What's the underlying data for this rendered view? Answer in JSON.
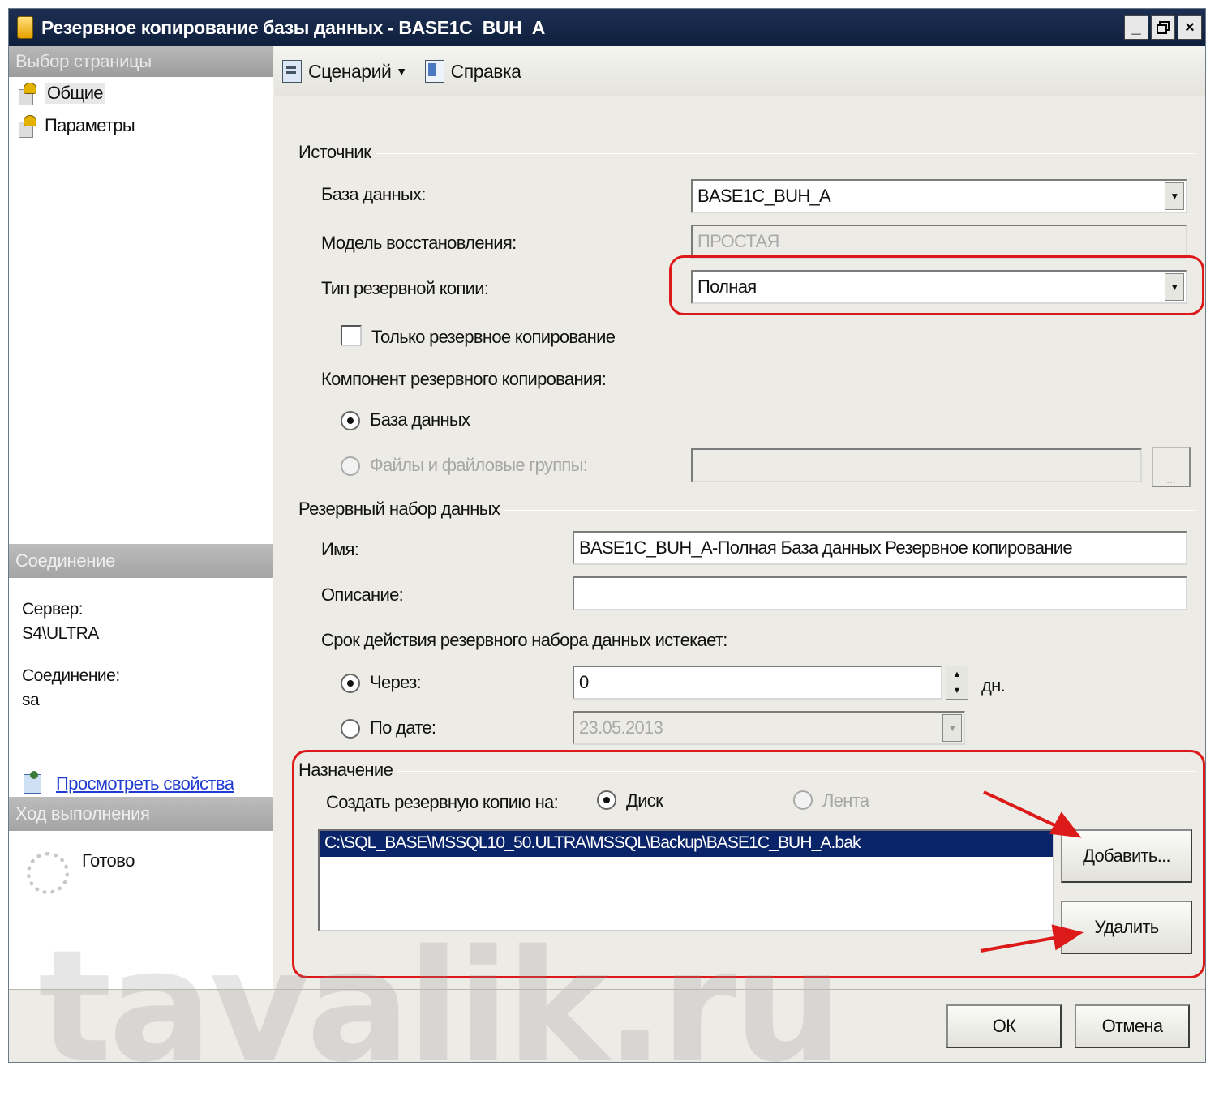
{
  "window": {
    "title": "Резервное копирование базы данных - BASE1C_BUH_A",
    "buttons": {
      "minimize": "_",
      "maximize": "ð",
      "close": "×"
    }
  },
  "sidebar": {
    "header": "Выбор страницы",
    "pages": [
      {
        "label": "Общие",
        "selected": true
      },
      {
        "label": "Параметры",
        "selected": false
      }
    ]
  },
  "connection": {
    "header": "Соединение",
    "server_label": "Сервер:",
    "server_value": "S4\\ULTRA",
    "connection_label": "Соединение:",
    "connection_value": "sa",
    "view_link": "Просмотреть свойства соединения"
  },
  "progress": {
    "header": "Ход выполнения",
    "status": "Готово"
  },
  "toolbar": {
    "script_label": "Сценарий",
    "help_label": "Справка"
  },
  "source": {
    "group_title": "Источник",
    "database_label": "База данных:",
    "database_value": "BASE1C_BUH_A",
    "recovery_label": "Модель восстановления:",
    "recovery_value": "ПРОСТАЯ",
    "backup_type_label": "Тип резервной копии:",
    "backup_type_value": "Полная",
    "copy_only_label": "Только резервное копирование",
    "component_label": "Компонент резервного копирования:",
    "component_database": "База данных",
    "component_files": "Файлы и файловые группы:",
    "files_browse": "..."
  },
  "backup_set": {
    "group_title": "Резервный набор данных",
    "name_label": "Имя:",
    "name_value": "BASE1C_BUH_A-Полная База данных Резервное копирование",
    "description_label": "Описание:",
    "description_value": "",
    "expires_label": "Срок действия резервного набора данных истекает:",
    "after_label": "Через:",
    "after_value": "0",
    "days_unit": "дн.",
    "on_label": "По дате:",
    "on_value": "23.05.2013"
  },
  "destination": {
    "group_title": "Назначение",
    "backup_to_label": "Создать резервную копию на:",
    "disk_label": "Диск",
    "tape_label": "Лента",
    "paths": [
      "C:\\SQL_BASE\\MSSQL10_50.ULTRA\\MSSQL\\Backup\\BASE1C_BUH_A.bak"
    ],
    "add_button": "Добавить...",
    "remove_button": "Удалить"
  },
  "footer": {
    "ok_button": "ОК",
    "cancel_button": "Отмена"
  },
  "watermark": "tavalik.ru",
  "colors": {
    "titlebar": "#0f1f3d",
    "highlight": "#dc1a1a",
    "selection": "#0a246a",
    "link": "#1f3bd0"
  }
}
